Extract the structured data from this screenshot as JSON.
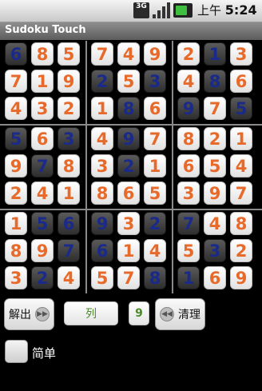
{
  "status_bar": {
    "network": "3G",
    "time_prefix": "上午",
    "time": "5:24"
  },
  "app": {
    "title": "Sudoku Touch"
  },
  "grid": {
    "rows": [
      [
        6,
        8,
        5,
        7,
        4,
        9,
        2,
        1,
        3
      ],
      [
        7,
        1,
        9,
        2,
        5,
        3,
        4,
        8,
        6
      ],
      [
        4,
        3,
        2,
        1,
        8,
        6,
        9,
        7,
        5
      ],
      [
        5,
        6,
        3,
        4,
        9,
        7,
        8,
        2,
        1
      ],
      [
        9,
        7,
        8,
        3,
        2,
        1,
        6,
        5,
        4
      ],
      [
        2,
        4,
        1,
        8,
        6,
        5,
        3,
        9,
        7
      ],
      [
        1,
        5,
        6,
        9,
        3,
        2,
        7,
        4,
        8
      ],
      [
        8,
        9,
        7,
        6,
        1,
        4,
        5,
        3,
        2
      ],
      [
        3,
        2,
        4,
        5,
        7,
        8,
        1,
        6,
        9
      ]
    ],
    "given": [
      [
        1,
        0,
        0,
        0,
        0,
        0,
        0,
        1,
        0
      ],
      [
        0,
        0,
        0,
        1,
        0,
        1,
        0,
        1,
        0
      ],
      [
        0,
        0,
        0,
        0,
        1,
        0,
        1,
        0,
        1
      ],
      [
        1,
        0,
        1,
        0,
        1,
        0,
        0,
        0,
        0
      ],
      [
        0,
        1,
        0,
        0,
        1,
        0,
        0,
        0,
        0
      ],
      [
        0,
        0,
        0,
        0,
        0,
        0,
        0,
        0,
        0
      ],
      [
        0,
        1,
        1,
        1,
        0,
        1,
        1,
        0,
        0
      ],
      [
        0,
        0,
        1,
        1,
        0,
        0,
        0,
        1,
        0
      ],
      [
        0,
        1,
        0,
        0,
        0,
        1,
        1,
        0,
        0
      ]
    ]
  },
  "controls": {
    "solve_label": "解出",
    "mode_label": "列",
    "number_value": "9",
    "clear_label": "清理",
    "simple_label": "简单",
    "simple_checked": false
  }
}
